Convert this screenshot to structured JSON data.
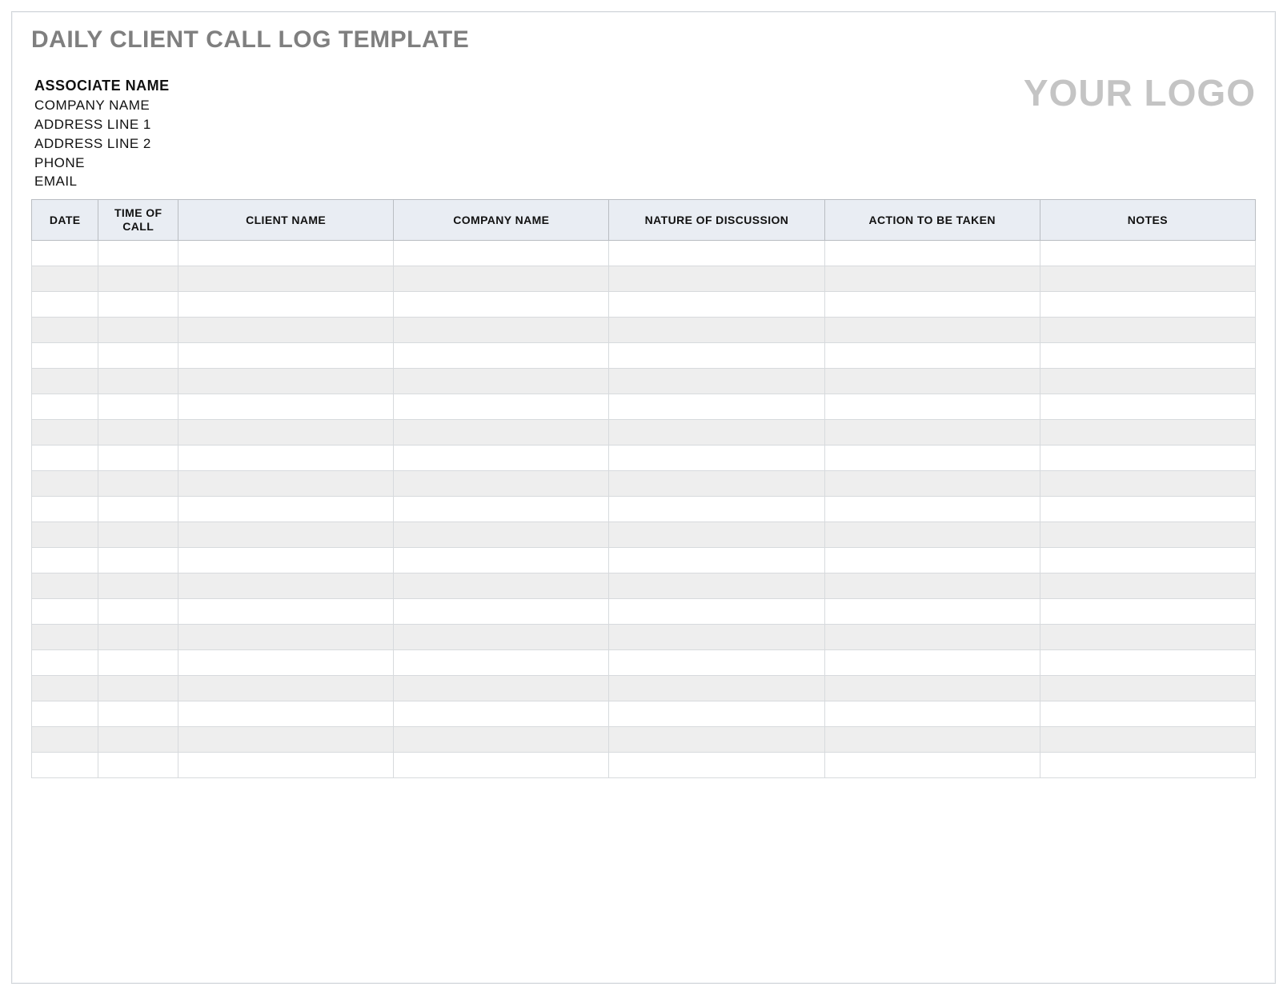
{
  "title": "DAILY CLIENT CALL LOG TEMPLATE",
  "associate": {
    "name": "ASSOCIATE NAME",
    "company": "COMPANY NAME",
    "address1": "ADDRESS LINE 1",
    "address2": "ADDRESS LINE 2",
    "phone": "PHONE",
    "email": "EMAIL"
  },
  "logo_text": "YOUR LOGO",
  "columns": [
    "DATE",
    "TIME OF CALL",
    "CLIENT NAME",
    "COMPANY NAME",
    "NATURE OF DISCUSSION",
    "ACTION TO BE TAKEN",
    "NOTES"
  ],
  "rows": [
    {
      "date": "",
      "time": "",
      "client": "",
      "company": "",
      "nature": "",
      "action": "",
      "notes": ""
    },
    {
      "date": "",
      "time": "",
      "client": "",
      "company": "",
      "nature": "",
      "action": "",
      "notes": ""
    },
    {
      "date": "",
      "time": "",
      "client": "",
      "company": "",
      "nature": "",
      "action": "",
      "notes": ""
    },
    {
      "date": "",
      "time": "",
      "client": "",
      "company": "",
      "nature": "",
      "action": "",
      "notes": ""
    },
    {
      "date": "",
      "time": "",
      "client": "",
      "company": "",
      "nature": "",
      "action": "",
      "notes": ""
    },
    {
      "date": "",
      "time": "",
      "client": "",
      "company": "",
      "nature": "",
      "action": "",
      "notes": ""
    },
    {
      "date": "",
      "time": "",
      "client": "",
      "company": "",
      "nature": "",
      "action": "",
      "notes": ""
    },
    {
      "date": "",
      "time": "",
      "client": "",
      "company": "",
      "nature": "",
      "action": "",
      "notes": ""
    },
    {
      "date": "",
      "time": "",
      "client": "",
      "company": "",
      "nature": "",
      "action": "",
      "notes": ""
    },
    {
      "date": "",
      "time": "",
      "client": "",
      "company": "",
      "nature": "",
      "action": "",
      "notes": ""
    },
    {
      "date": "",
      "time": "",
      "client": "",
      "company": "",
      "nature": "",
      "action": "",
      "notes": ""
    },
    {
      "date": "",
      "time": "",
      "client": "",
      "company": "",
      "nature": "",
      "action": "",
      "notes": ""
    },
    {
      "date": "",
      "time": "",
      "client": "",
      "company": "",
      "nature": "",
      "action": "",
      "notes": ""
    },
    {
      "date": "",
      "time": "",
      "client": "",
      "company": "",
      "nature": "",
      "action": "",
      "notes": ""
    },
    {
      "date": "",
      "time": "",
      "client": "",
      "company": "",
      "nature": "",
      "action": "",
      "notes": ""
    },
    {
      "date": "",
      "time": "",
      "client": "",
      "company": "",
      "nature": "",
      "action": "",
      "notes": ""
    },
    {
      "date": "",
      "time": "",
      "client": "",
      "company": "",
      "nature": "",
      "action": "",
      "notes": ""
    },
    {
      "date": "",
      "time": "",
      "client": "",
      "company": "",
      "nature": "",
      "action": "",
      "notes": ""
    },
    {
      "date": "",
      "time": "",
      "client": "",
      "company": "",
      "nature": "",
      "action": "",
      "notes": ""
    },
    {
      "date": "",
      "time": "",
      "client": "",
      "company": "",
      "nature": "",
      "action": "",
      "notes": ""
    },
    {
      "date": "",
      "time": "",
      "client": "",
      "company": "",
      "nature": "",
      "action": "",
      "notes": ""
    }
  ]
}
